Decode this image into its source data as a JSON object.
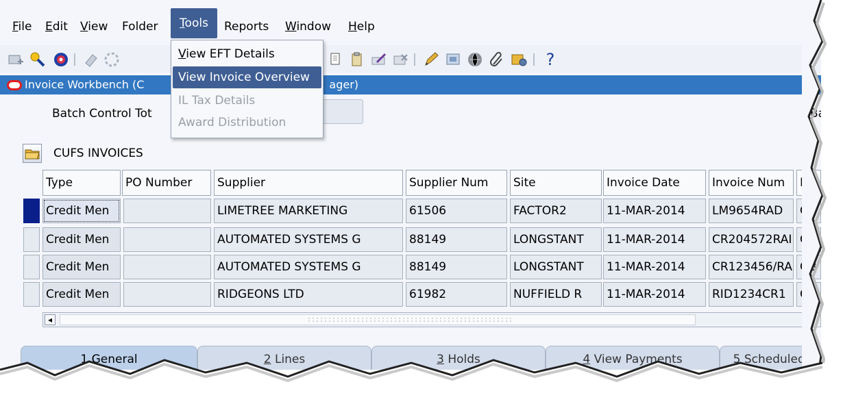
{
  "menubar": {
    "items": [
      {
        "label": "File",
        "mnemonic": "F",
        "rest": "ile"
      },
      {
        "label": "Edit",
        "mnemonic": "E",
        "rest": "dit"
      },
      {
        "label": "View",
        "mnemonic": "V",
        "rest": "iew"
      },
      {
        "label": "Folder",
        "mnemonic": "",
        "rest": "Folder"
      },
      {
        "label": "Tools",
        "mnemonic": "T",
        "rest": "ools"
      },
      {
        "label": "Reports",
        "mnemonic": "",
        "rest": "Reports"
      },
      {
        "label": "Window",
        "mnemonic": "W",
        "rest": "indow"
      },
      {
        "label": "Help",
        "mnemonic": "H",
        "rest": "elp"
      }
    ]
  },
  "tools_menu": {
    "items": [
      {
        "mnemonic": "V",
        "rest": "iew EFT Details",
        "state": "normal"
      },
      {
        "mnemonic": "",
        "rest": "View Invoice Overview",
        "state": "highlighted"
      },
      {
        "mnemonic": "",
        "rest": "IL Tax Details",
        "state": "disabled"
      },
      {
        "mnemonic": "",
        "rest": "Award Distribution",
        "state": "disabled"
      }
    ]
  },
  "toolbar": {
    "icons": [
      "new-record-icon",
      "find-icon",
      "navigator-icon",
      "save-icon",
      "next-step-icon",
      "cut-icon",
      "copy-icon",
      "paste-icon",
      "clear-record-icon",
      "delete-record-icon",
      "edit-field-icon",
      "zoom-icon",
      "translations-icon",
      "attachments-icon",
      "folder-tools-icon",
      "help-icon"
    ],
    "help_glyph": "?"
  },
  "window": {
    "title": "Invoice Workbench (C",
    "title_tail": "ager)"
  },
  "form": {
    "batch_control_label": "Batch Control Tot",
    "batch_right_label": "Ba",
    "folder_title": "CUFS INVOICES"
  },
  "grid": {
    "columns": [
      "Type",
      "PO Number",
      "Supplier",
      "Supplier Num",
      "Site",
      "Invoice Date",
      "Invoice Num",
      "I"
    ],
    "rows": [
      [
        "Credit Men",
        "",
        "LIMETREE MARKETING",
        "61506",
        "FACTOR2",
        "11-MAR-2014",
        "LM9654RAD",
        "GB"
      ],
      [
        "Credit Men",
        "",
        "AUTOMATED SYSTEMS G",
        "88149",
        "LONGSTANT",
        "11-MAR-2014",
        "CR204572RAI",
        "GB"
      ],
      [
        "Credit Men",
        "",
        "AUTOMATED SYSTEMS G",
        "88149",
        "LONGSTANT",
        "11-MAR-2014",
        "CR123456/RA",
        "GB"
      ],
      [
        "Credit Men",
        "",
        "RIDGEONS LTD",
        "61982",
        "NUFFIELD R",
        "11-MAR-2014",
        "RID1234CR1",
        "GB"
      ]
    ],
    "selected_row": 0,
    "scroll_left_glyph": "◂"
  },
  "tabs": [
    {
      "mnemonic": "1",
      "rest": " General",
      "active": true
    },
    {
      "mnemonic": "2",
      "rest": " Lines",
      "active": false
    },
    {
      "mnemonic": "3",
      "rest": " Holds",
      "active": false
    },
    {
      "mnemonic": "4",
      "rest": " View Payments",
      "active": false
    },
    {
      "mnemonic": "5",
      "rest": " Scheduled P",
      "active": false
    }
  ],
  "colors": {
    "title_bar": "#3277c1",
    "menu_highlight": "#3f5f94",
    "selected_row": "#0b1f8a",
    "oracle_logo": "#e01e1e"
  }
}
